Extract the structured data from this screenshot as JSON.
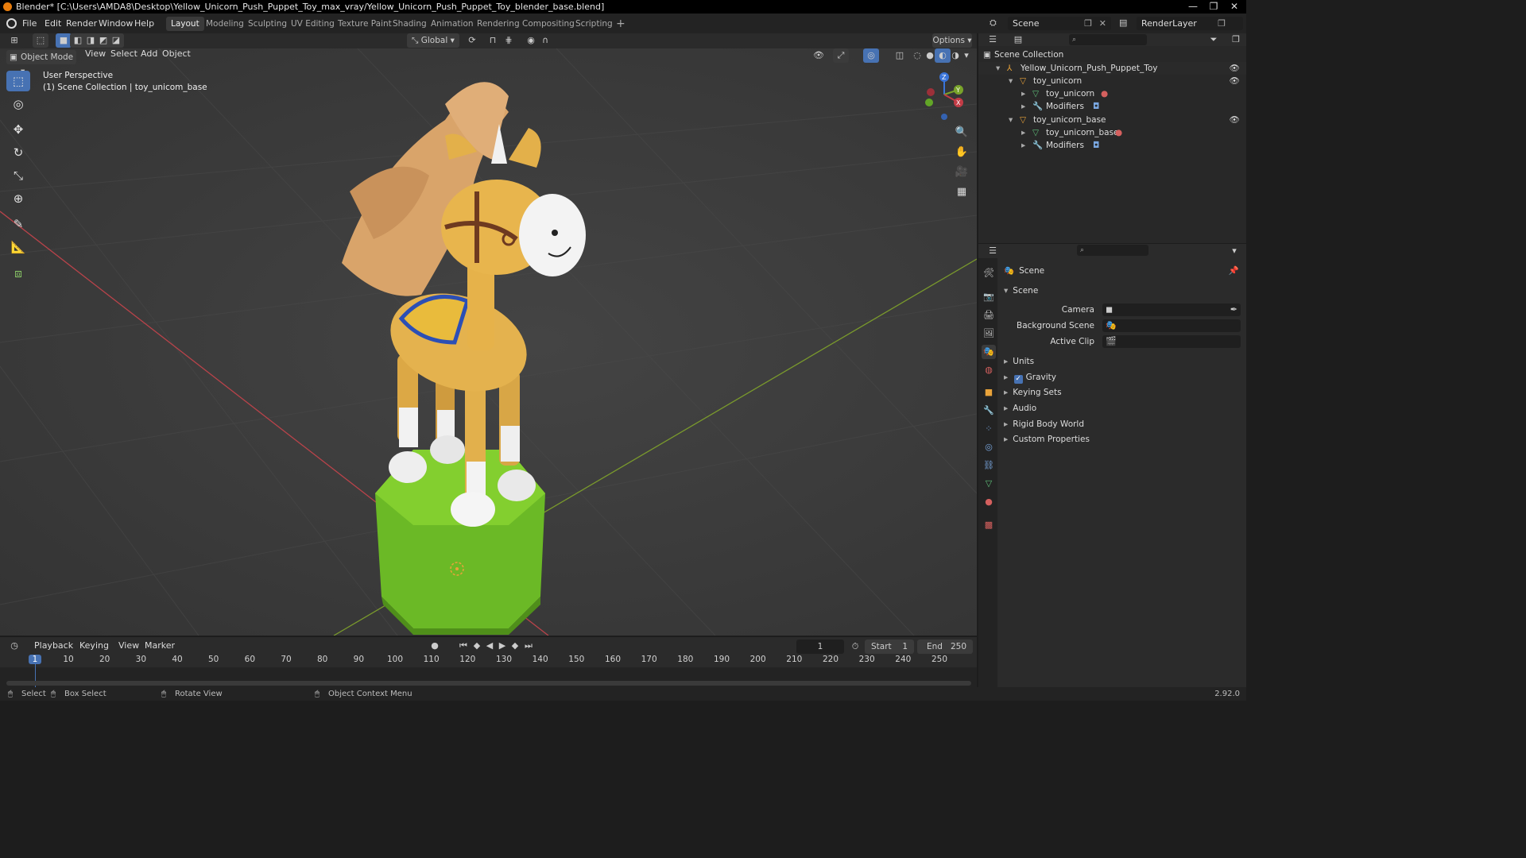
{
  "window": {
    "title": "Blender* [C:\\Users\\AMDA8\\Desktop\\Yellow_Unicorn_Push_Puppet_Toy_max_vray/Yellow_Unicorn_Push_Puppet_Toy_blender_base.blend]",
    "controls": [
      "—",
      "❐",
      "✕"
    ]
  },
  "menus": [
    "File",
    "Edit",
    "Render",
    "Window",
    "Help"
  ],
  "workspaces": [
    {
      "label": "Layout",
      "active": true
    },
    {
      "label": "Modeling"
    },
    {
      "label": "Sculpting"
    },
    {
      "label": "UV Editing"
    },
    {
      "label": "Texture Paint"
    },
    {
      "label": "Shading"
    },
    {
      "label": "Animation"
    },
    {
      "label": "Rendering"
    },
    {
      "label": "Compositing"
    },
    {
      "label": "Scripting"
    }
  ],
  "add_workspace": "+",
  "scene_selector": {
    "scene": "Scene",
    "view_layer": "RenderLayer"
  },
  "viewport_header": {
    "transform_orientation": "Global",
    "options": "Options",
    "mode": "Object Mode",
    "menus": [
      "View",
      "Select",
      "Add",
      "Object"
    ]
  },
  "viewport_overlay": {
    "line1": "User Perspective",
    "line2": "(1) Scene Collection | toy_unicom_base"
  },
  "gizmo_axes": [
    "Z",
    "Y",
    "X"
  ],
  "outliner": {
    "root": "Scene Collection",
    "rows": [
      {
        "label": "Yellow_Unicorn_Push_Puppet_Toy",
        "indent": 1
      },
      {
        "label": "toy_unicorn",
        "indent": 2
      },
      {
        "label": "toy_unicorn",
        "indent": 3
      },
      {
        "label": "Modifiers",
        "indent": 3
      },
      {
        "label": "toy_unicorn_base",
        "indent": 2
      },
      {
        "label": "toy_unicorn_base",
        "indent": 3
      },
      {
        "label": "Modifiers",
        "indent": 3
      }
    ]
  },
  "properties": {
    "header": "Scene",
    "panel": "Scene",
    "fields": [
      {
        "label": "Camera"
      },
      {
        "label": "Background Scene"
      },
      {
        "label": "Active Clip"
      }
    ],
    "sections": [
      "Units",
      "Gravity",
      "Keying Sets",
      "Audio",
      "Rigid Body World",
      "Custom Properties"
    ],
    "gravity_checked": true
  },
  "timeline": {
    "menus": [
      "Playback",
      "Keying",
      "View",
      "Marker"
    ],
    "current_frame": "1",
    "start_label": "Start",
    "start": "1",
    "end_label": "End",
    "end": "250",
    "ticks": [
      "1",
      "10",
      "20",
      "30",
      "40",
      "50",
      "60",
      "70",
      "80",
      "90",
      "100",
      "110",
      "120",
      "130",
      "140",
      "150",
      "160",
      "170",
      "180",
      "190",
      "200",
      "210",
      "220",
      "230",
      "240",
      "250"
    ]
  },
  "status": {
    "select": "Select",
    "box_select": "Box Select",
    "rotate_view": "Rotate View",
    "context_menu": "Object Context Menu",
    "version": "2.92.0"
  },
  "colors": {
    "accent": "#4772b3",
    "x_axis": "#c33c46",
    "y_axis": "#79a32a",
    "z_axis": "#3a74d9",
    "toy_yellow": "#e4b24e",
    "base_green": "#6fbd26",
    "mane": "#d9a46a"
  }
}
